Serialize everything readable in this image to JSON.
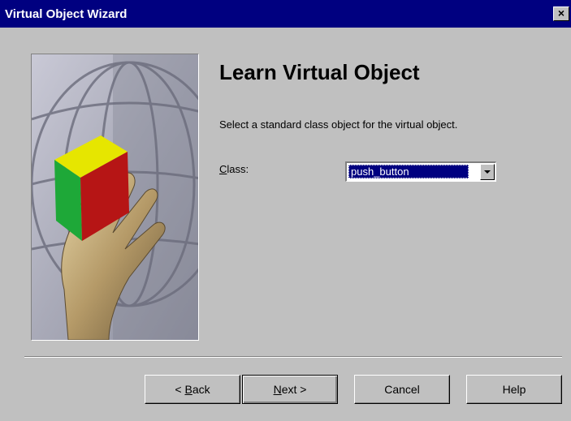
{
  "window": {
    "title": "Virtual Object Wizard",
    "close_label": "×"
  },
  "main": {
    "heading": "Learn Virtual Object",
    "description": "Select a standard class object for the virtual object.",
    "class_label_mnemonic": "C",
    "class_label_rest": "lass:",
    "class_value": "push_button"
  },
  "buttons": {
    "back_prefix": "< ",
    "back_mnemonic": "B",
    "back_rest": "ack",
    "next_mnemonic": "N",
    "next_rest": "ext >",
    "cancel": "Cancel",
    "help": "Help"
  },
  "icons": {
    "close": "close-icon",
    "dropdown": "chevron-down-icon"
  },
  "colors": {
    "titlebar": "#000080",
    "face": "#c0c0c0",
    "selection": "#000080"
  }
}
